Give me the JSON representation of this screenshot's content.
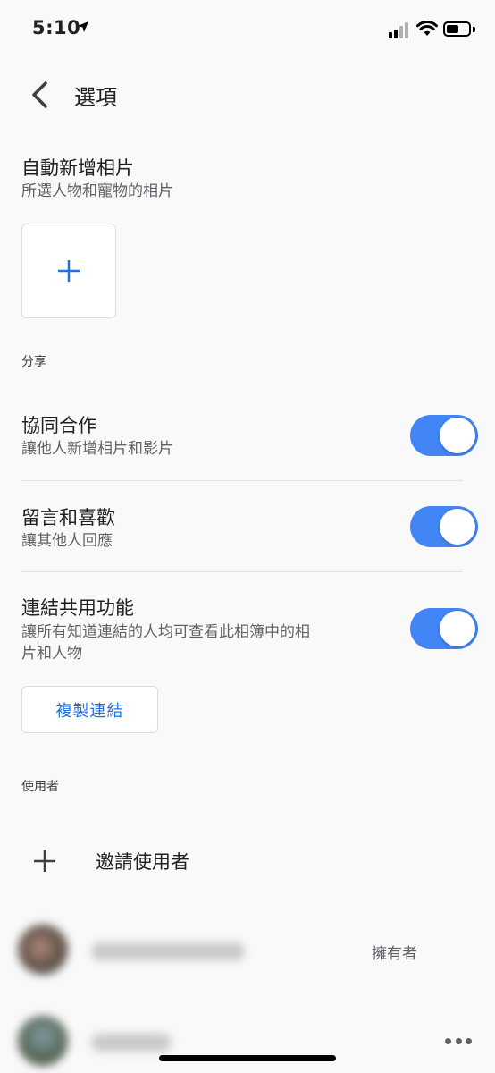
{
  "status_bar": {
    "time": "5:10"
  },
  "header": {
    "title": "選項"
  },
  "auto_add": {
    "title": "自動新增相片",
    "subtitle": "所選人物和寵物的相片",
    "add_symbol": "+"
  },
  "sharing": {
    "section_label": "分享",
    "items": [
      {
        "title": "協同合作",
        "subtitle": "讓他人新增相片和影片",
        "enabled": true
      },
      {
        "title": "留言和喜歡",
        "subtitle": "讓其他人回應",
        "enabled": true
      },
      {
        "title": "連結共用功能",
        "subtitle_line1": "讓所有知道連結的人均可查看此相簿中的相",
        "subtitle_line2": "片和人物",
        "enabled": true
      }
    ],
    "copy_link_label": "複製連結"
  },
  "users": {
    "section_label": "使用者",
    "invite_label": "邀請使用者",
    "list": [
      {
        "role": "擁有者"
      },
      {
        "role": ""
      }
    ]
  },
  "colors": {
    "accent": "#4285f4",
    "link": "#1a73e8"
  }
}
